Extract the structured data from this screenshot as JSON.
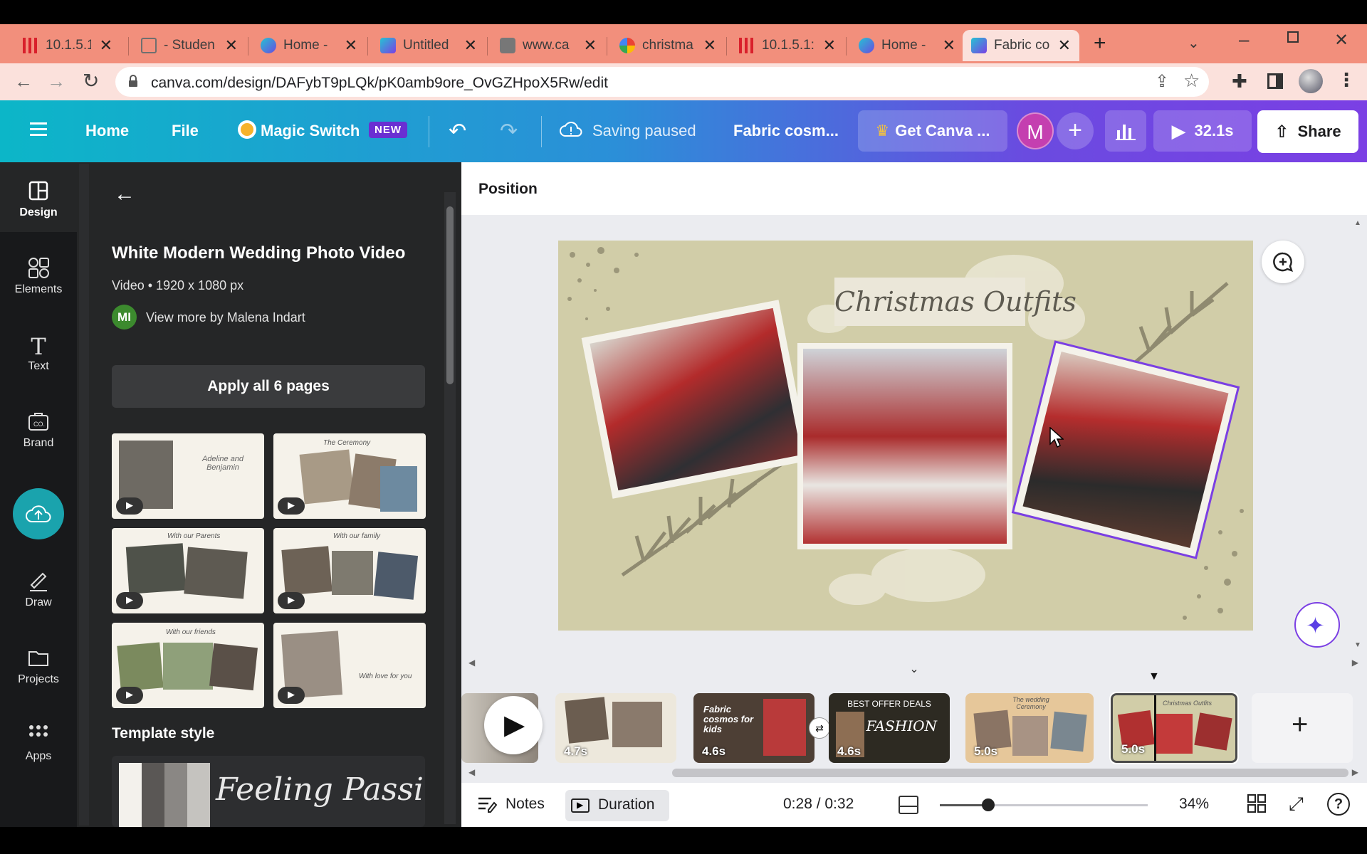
{
  "browser": {
    "tabs": [
      {
        "title": "10.1.5.1:",
        "icon": "pause-stripes-icon",
        "color": "#d9202b"
      },
      {
        "title": "- Studen",
        "icon": "image-icon",
        "color": "#6f6f6f"
      },
      {
        "title": "Home -",
        "icon": "canva-icon",
        "color": "#2f7fe6"
      },
      {
        "title": "Untitled",
        "icon": "video-icon",
        "color": "#7b3fe4"
      },
      {
        "title": "www.ca",
        "icon": "video-play-icon",
        "color": "#777"
      },
      {
        "title": "christma",
        "icon": "google-icon",
        "color": "#4285f4"
      },
      {
        "title": "10.1.5.1:",
        "icon": "pause-stripes-icon",
        "color": "#d9202b"
      },
      {
        "title": "Home -",
        "icon": "canva-icon",
        "color": "#2f7fe6"
      },
      {
        "title": "Fabric co",
        "icon": "video-icon",
        "color": "#7b3fe4"
      }
    ],
    "url": "canva.com/design/DAFybT9pLQk/pK0amb9ore_OvGZHpoX5Rw/edit"
  },
  "topbar": {
    "home": "Home",
    "file": "File",
    "magic_switch": "Magic Switch",
    "new_badge": "NEW",
    "saving_status": "Saving paused",
    "design_title": "Fabric cosm...",
    "get_canva": "Get Canva ...",
    "avatar_letter": "M",
    "play_time": "32.1s",
    "share": "Share"
  },
  "rail": [
    {
      "label": "Design",
      "icon": "design-icon"
    },
    {
      "label": "Elements",
      "icon": "elements-icon"
    },
    {
      "label": "Text",
      "icon": "text-icon"
    },
    {
      "label": "Brand",
      "icon": "brand-icon"
    },
    {
      "label": "Draw",
      "icon": "draw-icon"
    },
    {
      "label": "Projects",
      "icon": "projects-icon"
    },
    {
      "label": "Apps",
      "icon": "apps-icon"
    }
  ],
  "panel": {
    "template_title": "White Modern Wedding Photo Video",
    "meta": "Video • 1920 x 1080 px",
    "author_initials": "MI",
    "author_link": "View more by Malena Indart",
    "apply_button": "Apply all 6 pages",
    "template_style_heading": "Template style",
    "style_preview_text": "Feeling Passi",
    "thumbnails": [
      {
        "caption": "Adeline and Benjamin"
      },
      {
        "caption": "The Ceremony"
      },
      {
        "caption": "With our Parents"
      },
      {
        "caption": "With our family"
      },
      {
        "caption": "With our friends"
      },
      {
        "caption": "With love for you"
      }
    ]
  },
  "canvas": {
    "position_label": "Position",
    "slide_title": "Christmas Outfits"
  },
  "timeline": {
    "clips": [
      {
        "duration": "4.7s",
        "label": ""
      },
      {
        "duration": "4.6s",
        "label": "Fabric cosmos for kids"
      },
      {
        "duration": "4.6s",
        "label": "BEST OFFER DEALS",
        "sub": "FASHION"
      },
      {
        "duration": "5.0s",
        "label": "The wedding Ceremony"
      },
      {
        "duration": "5.0s",
        "label": "Christmas Outfits"
      }
    ]
  },
  "bottombar": {
    "notes": "Notes",
    "duration": "Duration",
    "time": "0:28 / 0:32",
    "zoom": "34%",
    "zoom_level": 0.34
  },
  "colors": {
    "accent": "#7b3fe4",
    "teal": "#0cb6c8",
    "slide_bg": "#d1cda8"
  }
}
